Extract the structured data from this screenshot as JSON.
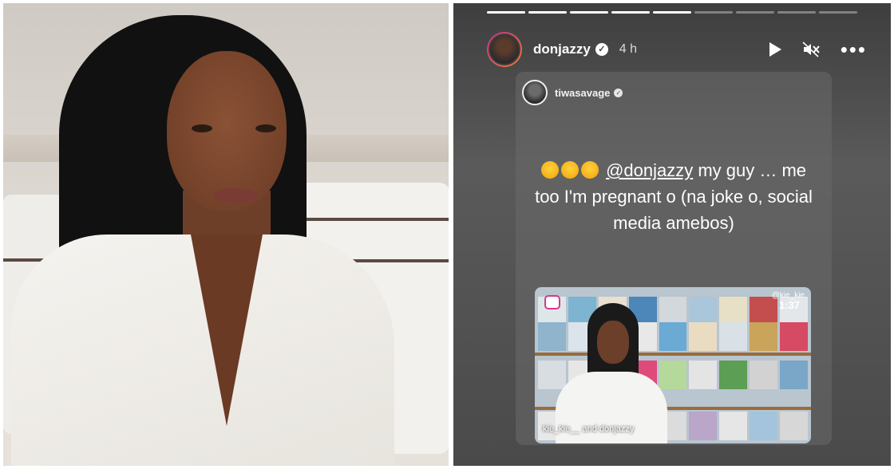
{
  "story": {
    "username": "donjazzy",
    "timestamp": "4 h",
    "progress_total": 9,
    "progress_done": 5,
    "actions": {
      "play_icon": "play-icon",
      "mute_icon": "speaker-muted-icon",
      "more_icon": "more-horizontal-icon"
    },
    "reshare": {
      "username": "tiwasavage",
      "caption_mention": "@donjazzy",
      "caption_text": " my guy … me too I'm pregnant o (na joke o, social media amebos)",
      "emoji_icon": "rolling-laughing-emoji-icon",
      "emoji_count": 3,
      "clip": {
        "handle": "@kie_kie",
        "time": "1:37",
        "credit": "kie_kie__ and donjazzy"
      }
    }
  },
  "colors": {
    "story_bg": "#4a4a4a",
    "story_ring": "#c13584",
    "text": "#ffffff"
  }
}
